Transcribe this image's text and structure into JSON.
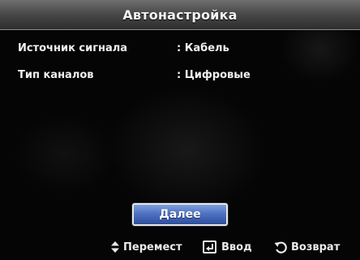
{
  "title": "Автонастройка",
  "settings": [
    {
      "label": "Источник сигнала",
      "value": ": Кабель"
    },
    {
      "label": "Тип каналов",
      "value": ": Цифровые"
    }
  ],
  "next_button_label": "Далее",
  "hints": {
    "move_label": "Перемест",
    "enter_label": "Ввод",
    "return_label": "Возврат"
  },
  "icons": {
    "move": "up-down-arrows-icon",
    "enter": "enter-icon",
    "return": "return-icon"
  },
  "colors": {
    "button_accent": "#4f72c2",
    "title_bar": "#4a4a4a",
    "background": "#050505"
  }
}
